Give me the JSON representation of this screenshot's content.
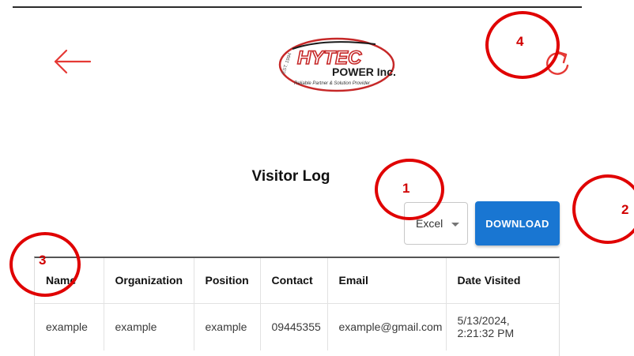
{
  "header": {
    "back_icon": "arrow-left-icon",
    "logo": {
      "brand": "HYTEC",
      "sub": "POWER Inc.",
      "tagline": "Reliable Partner & Solution Provider",
      "est": "EST. 1994"
    },
    "refresh_icon": "refresh-icon"
  },
  "page": {
    "title": "Visitor Log"
  },
  "export": {
    "selected_format": "Excel",
    "download_label": "DOWNLOAD"
  },
  "table": {
    "columns": [
      "Name",
      "Organization",
      "Position",
      "Contact",
      "Email",
      "Date Visited"
    ],
    "rows": [
      [
        "example",
        "example",
        "example",
        "09445355",
        "example@gmail.com",
        "5/13/2024, 2:21:32 PM"
      ]
    ]
  },
  "annotations": [
    "1",
    "2",
    "3",
    "4"
  ],
  "colors": {
    "accent": "#1976d2",
    "icon_red": "#e53935",
    "annotation_red": "#e00000"
  }
}
